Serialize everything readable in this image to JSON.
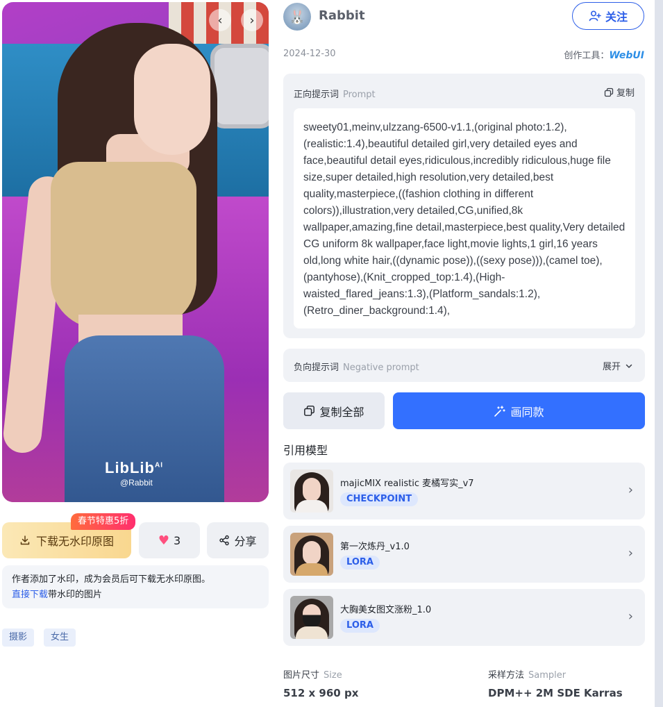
{
  "image": {
    "prev_icon": "chevron-left",
    "next_icon": "chevron-right",
    "watermark_brand": "LibLib",
    "watermark_brand_sup": "AI",
    "watermark_user": "@Rabbit"
  },
  "actions": {
    "download_label": "下载无水印原图",
    "promo_badge": "春节特惠5折",
    "like_count": "3",
    "share_label": "分享"
  },
  "notice": {
    "text": "作者添加了水印，成为会员后可下载无水印原图。",
    "link_text": "直接下载",
    "link_suffix": "带水印的图片"
  },
  "tags": [
    "摄影",
    "女生"
  ],
  "author": {
    "name": "Rabbit",
    "follow_label": "关注"
  },
  "post": {
    "date": "2024-12-30",
    "tool_label": "创作工具：",
    "tool_name": "WebUI"
  },
  "prompt": {
    "label": "正向提示词",
    "label_en": "Prompt",
    "copy_label": "复制",
    "text": "sweety01,meinv,ulzzang-6500-v1.1,(original photo:1.2),(realistic:1.4),beautiful detailed girl,very detailed eyes and face,beautiful detail eyes,ridiculous,incredibly ridiculous,huge file size,super detailed,high resolution,very detailed,best quality,masterpiece,((fashion clothing in different colors)),illustration,very detailed,CG,unified,8k wallpaper,amazing,fine detail,masterpiece,best quality,Very detailed CG uniform 8k wallpaper,face light,movie lights,1 girl,16 years old,long white hair,((dynamic pose)),((sexy pose))),(camel toe),(pantyhose),(Knit_cropped_top:1.4),(High-waisted_flared_jeans:1.3),(Platform_sandals:1.2),(Retro_diner_background:1.4),"
  },
  "negative": {
    "label": "负向提示词",
    "label_en": "Negative prompt",
    "expand_label": "展开"
  },
  "buttons": {
    "copy_all": "复制全部",
    "draw_same": "画同款"
  },
  "models": {
    "title": "引用模型",
    "items": [
      {
        "name": "majicMIX realistic 麦橘写实_v7",
        "type": "CHECKPOINT"
      },
      {
        "name": "第一次炼丹_v1.0",
        "type": "LORA"
      },
      {
        "name": "大胸美女图文涨粉_1.0",
        "type": "LORA"
      }
    ]
  },
  "meta": {
    "size_label": "图片尺寸",
    "size_label_en": "Size",
    "size_value": "512 x 960 px",
    "sampler_label": "采样方法",
    "sampler_label_en": "Sampler",
    "sampler_value": "DPM++ 2M SDE Karras"
  },
  "colors": {
    "accent": "#3370ff",
    "link": "#2c5ee8",
    "tool_name": "#2e8fe6"
  }
}
